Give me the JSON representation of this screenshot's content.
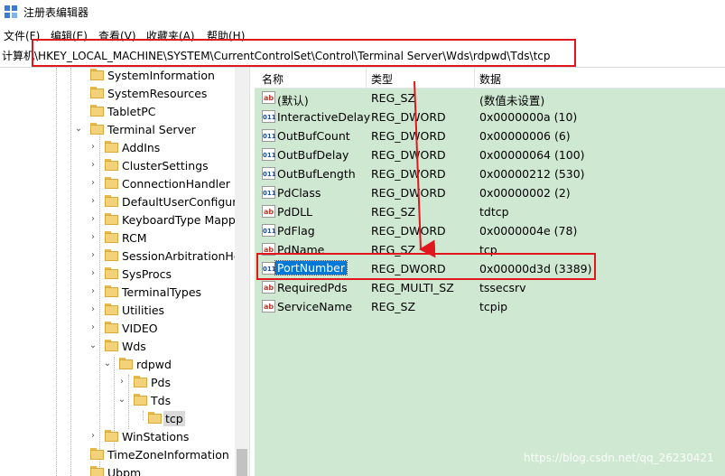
{
  "window": {
    "title": "注册表编辑器"
  },
  "menu": [
    {
      "label": "文件(F)"
    },
    {
      "label": "编辑(E)"
    },
    {
      "label": "查看(V)"
    },
    {
      "label": "收藏夹(A)"
    },
    {
      "label": "帮助(H)"
    }
  ],
  "address": {
    "path": "计算机\\HKEY_LOCAL_MACHINE\\SYSTEM\\CurrentControlSet\\Control\\Terminal Server\\Wds\\rdpwd\\Tds\\tcp"
  },
  "tree": {
    "items": [
      {
        "label": "SystemInformation",
        "expanded": false
      },
      {
        "label": "SystemResources",
        "expanded": false
      },
      {
        "label": "TabletPC",
        "expanded": false
      },
      {
        "label": "Terminal Server",
        "expanded": true
      },
      {
        "label": "AddIns",
        "expanded": false
      },
      {
        "label": "ClusterSettings",
        "expanded": false
      },
      {
        "label": "ConnectionHandler",
        "expanded": false
      },
      {
        "label": "DefaultUserConfigura",
        "expanded": false
      },
      {
        "label": "KeyboardType Mapp",
        "expanded": false
      },
      {
        "label": "RCM",
        "expanded": false
      },
      {
        "label": "SessionArbitrationHel",
        "expanded": false
      },
      {
        "label": "SysProcs",
        "expanded": false
      },
      {
        "label": "TerminalTypes",
        "expanded": false
      },
      {
        "label": "Utilities",
        "expanded": false
      },
      {
        "label": "VIDEO",
        "expanded": false
      },
      {
        "label": "Wds",
        "expanded": true
      },
      {
        "label": "rdpwd",
        "expanded": true
      },
      {
        "label": "Pds",
        "expanded": false
      },
      {
        "label": "Tds",
        "expanded": true
      },
      {
        "label": "tcp",
        "selected": true
      },
      {
        "label": "WinStations",
        "expanded": false
      },
      {
        "label": "TimeZoneInformation",
        "expanded": false
      },
      {
        "label": "Ubpm",
        "expanded": false
      }
    ]
  },
  "list": {
    "columns": {
      "name": "名称",
      "type": "类型",
      "data": "数据"
    },
    "rows": [
      {
        "name": "(默认)",
        "type": "REG_SZ",
        "data": "(数值未设置)",
        "icon": "string-value-icon"
      },
      {
        "name": "InteractiveDelay",
        "type": "REG_DWORD",
        "data": "0x0000000a (10)",
        "icon": "binary-value-icon"
      },
      {
        "name": "OutBufCount",
        "type": "REG_DWORD",
        "data": "0x00000006 (6)",
        "icon": "binary-value-icon"
      },
      {
        "name": "OutBufDelay",
        "type": "REG_DWORD",
        "data": "0x00000064 (100)",
        "icon": "binary-value-icon"
      },
      {
        "name": "OutBufLength",
        "type": "REG_DWORD",
        "data": "0x00000212 (530)",
        "icon": "binary-value-icon"
      },
      {
        "name": "PdClass",
        "type": "REG_DWORD",
        "data": "0x00000002 (2)",
        "icon": "binary-value-icon"
      },
      {
        "name": "PdDLL",
        "type": "REG_SZ",
        "data": "tdtcp",
        "icon": "string-value-icon"
      },
      {
        "name": "PdFlag",
        "type": "REG_DWORD",
        "data": "0x0000004e (78)",
        "icon": "binary-value-icon"
      },
      {
        "name": "PdName",
        "type": "REG_SZ",
        "data": "tcp",
        "icon": "string-value-icon"
      },
      {
        "name": "PortNumber",
        "type": "REG_DWORD",
        "data": "0x00000d3d (3389)",
        "icon": "binary-value-icon",
        "selected": true
      },
      {
        "name": "RequiredPds",
        "type": "REG_MULTI_SZ",
        "data": "tssecsrv",
        "icon": "string-value-icon"
      },
      {
        "name": "ServiceName",
        "type": "REG_SZ",
        "data": "tcpip",
        "icon": "string-value-icon"
      }
    ]
  },
  "watermark": "https://blog.csdn.net/qq_26230421",
  "colors": {
    "list_background": "#cfe8d2",
    "selection": "#0078d7",
    "annotation": "#e0181e"
  }
}
